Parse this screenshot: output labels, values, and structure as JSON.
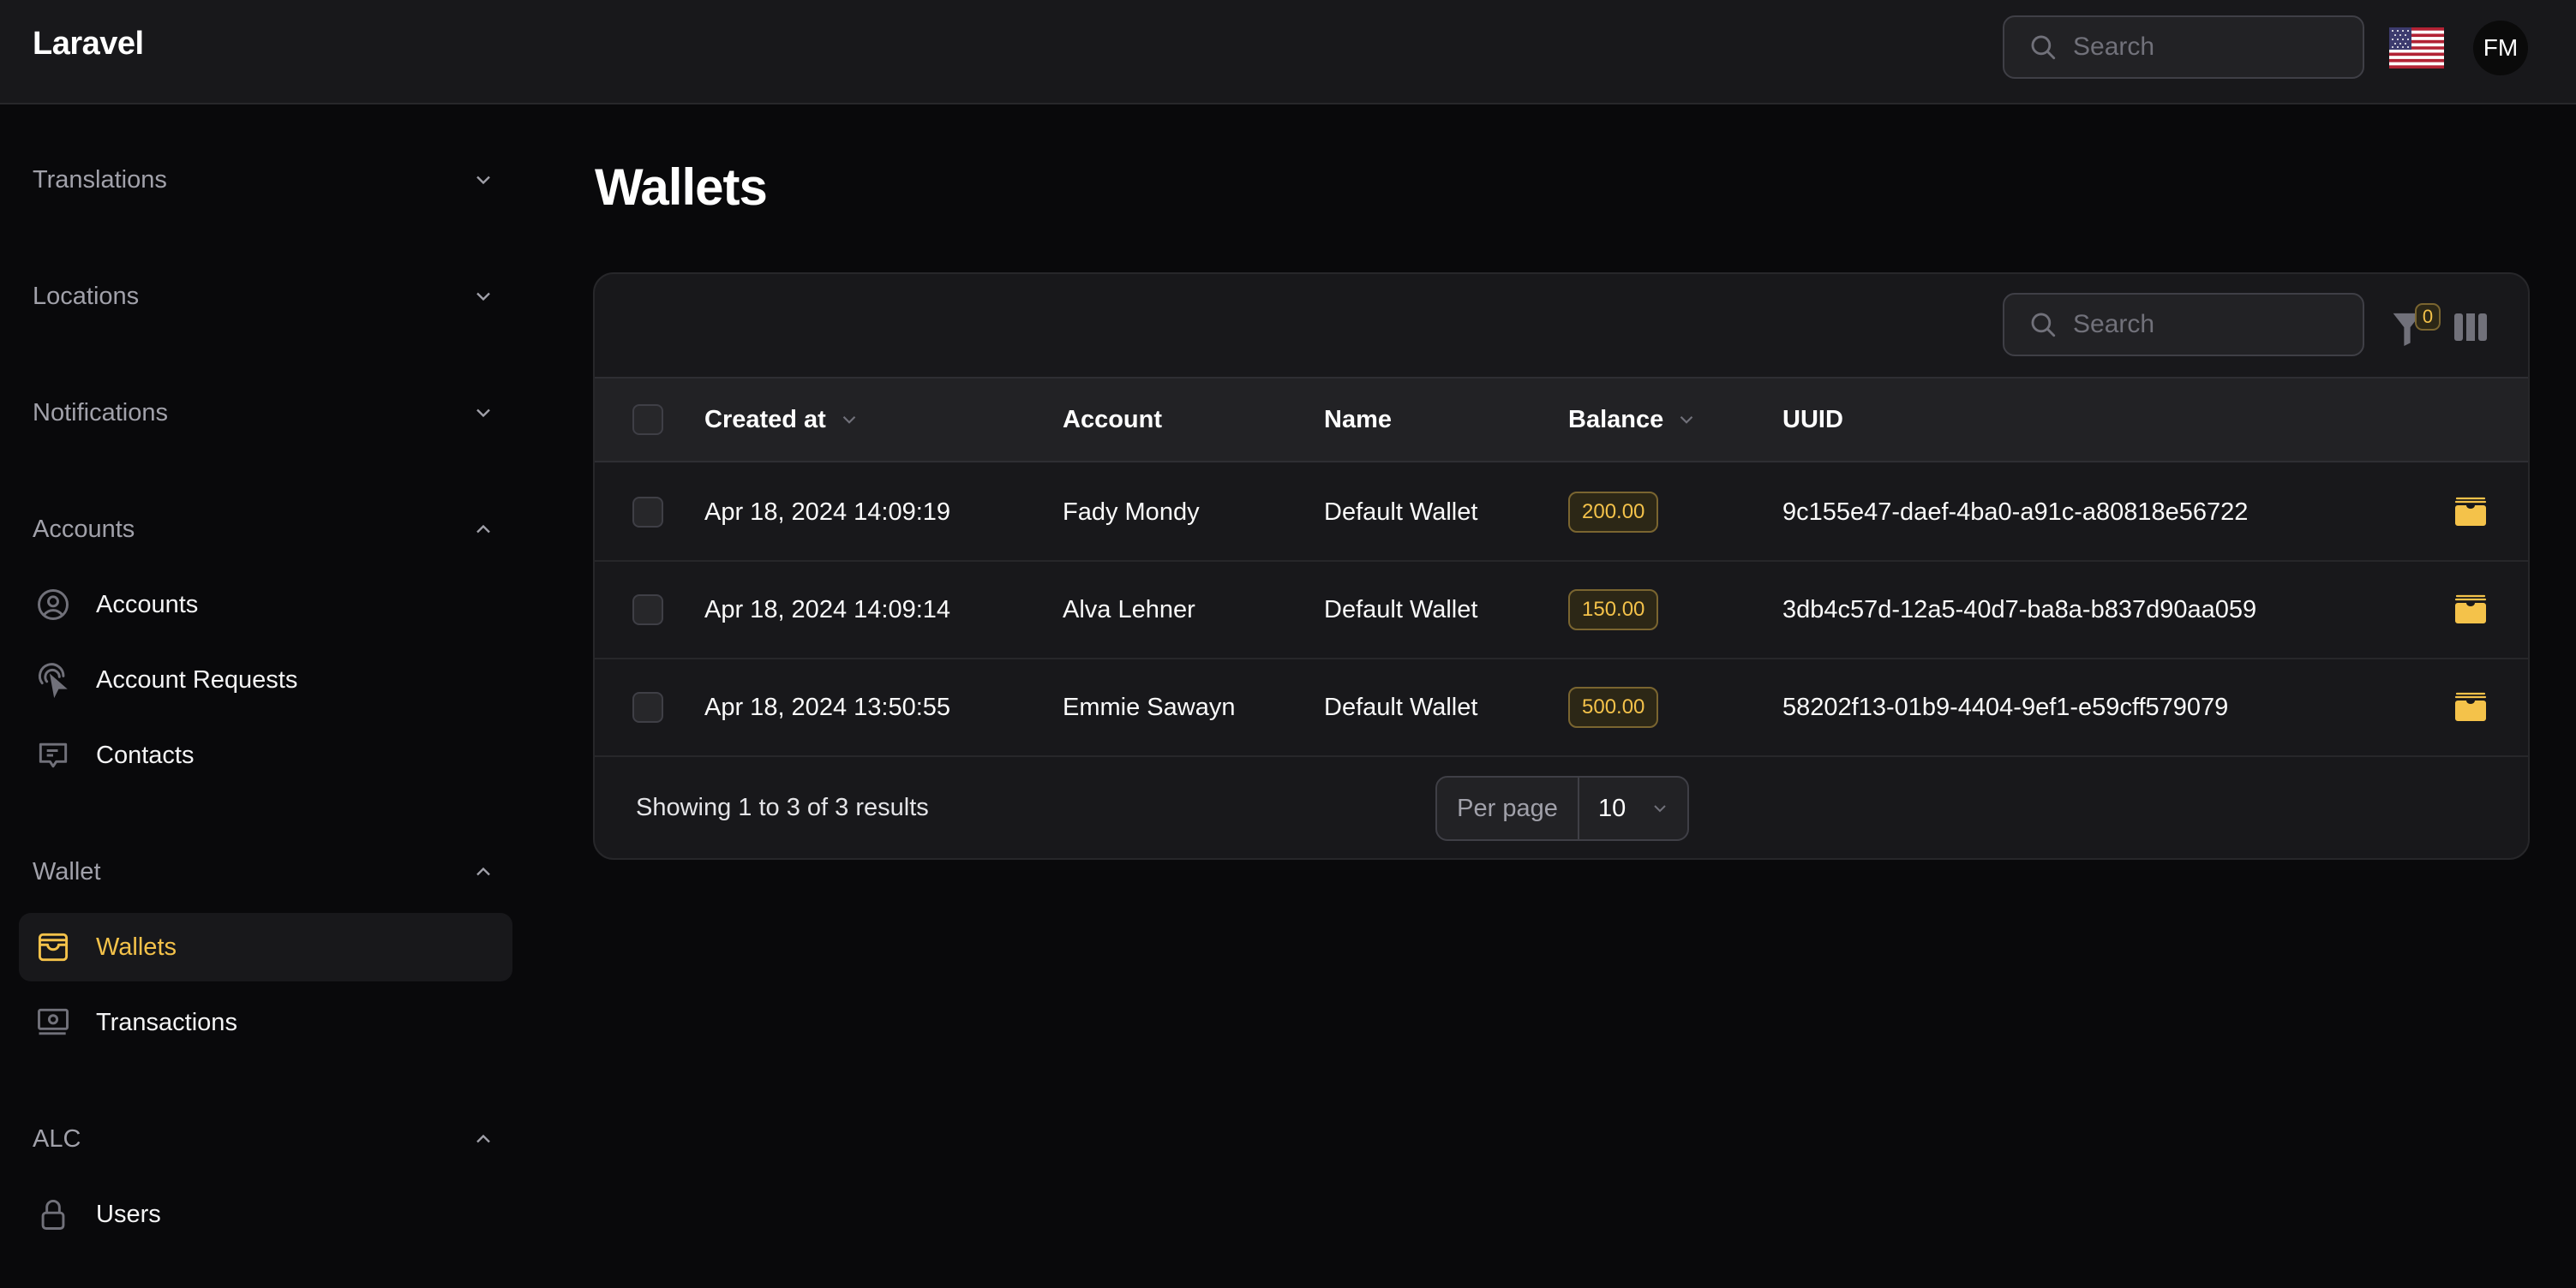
{
  "app": {
    "brand": "Laravel",
    "search_placeholder": "Search",
    "locale_flag": "us-flag",
    "user_initials": "FM"
  },
  "colors": {
    "accent": "#f4c24a",
    "background": "#09090b",
    "surface": "#18181b",
    "header_row": "#222225",
    "muted_text": "#a1a1aa"
  },
  "sidebar": {
    "groups": [
      {
        "label": "Translations",
        "expanded": false,
        "items": []
      },
      {
        "label": "Locations",
        "expanded": false,
        "items": []
      },
      {
        "label": "Notifications",
        "expanded": false,
        "items": []
      },
      {
        "label": "Accounts",
        "expanded": true,
        "items": [
          {
            "label": "Accounts",
            "icon": "user-circle-icon",
            "active": false
          },
          {
            "label": "Account Requests",
            "icon": "cursor-click-icon",
            "active": false
          },
          {
            "label": "Contacts",
            "icon": "chat-bubble-icon",
            "active": false
          }
        ]
      },
      {
        "label": "Wallet",
        "expanded": true,
        "items": [
          {
            "label": "Wallets",
            "icon": "wallet-icon",
            "active": true
          },
          {
            "label": "Transactions",
            "icon": "banknotes-icon",
            "active": false
          }
        ]
      },
      {
        "label": "ALC",
        "expanded": true,
        "items": [
          {
            "label": "Users",
            "icon": "lock-icon",
            "active": false
          }
        ]
      }
    ]
  },
  "main": {
    "title": "Wallets",
    "table": {
      "search_placeholder": "Search",
      "active_filter_count": "0",
      "columns": [
        {
          "label": "Created at",
          "sortable": true
        },
        {
          "label": "Account",
          "sortable": false
        },
        {
          "label": "Name",
          "sortable": false
        },
        {
          "label": "Balance",
          "sortable": true
        },
        {
          "label": "UUID",
          "sortable": false
        }
      ],
      "rows": [
        {
          "created_at": "Apr 18, 2024 14:09:19",
          "account": "Fady Mondy",
          "name": "Default Wallet",
          "balance": "200.00",
          "uuid": "9c155e47-daef-4ba0-a91c-a80818e56722"
        },
        {
          "created_at": "Apr 18, 2024 14:09:14",
          "account": "Alva Lehner",
          "name": "Default Wallet",
          "balance": "150.00",
          "uuid": "3db4c57d-12a5-40d7-ba8a-b837d90aa059"
        },
        {
          "created_at": "Apr 18, 2024 13:50:55",
          "account": "Emmie Sawayn",
          "name": "Default Wallet",
          "balance": "500.00",
          "uuid": "58202f13-01b9-4404-9ef1-e59cff579079"
        }
      ],
      "results_text": "Showing 1 to 3 of 3 results",
      "per_page_label": "Per page",
      "per_page_value": "10"
    }
  }
}
